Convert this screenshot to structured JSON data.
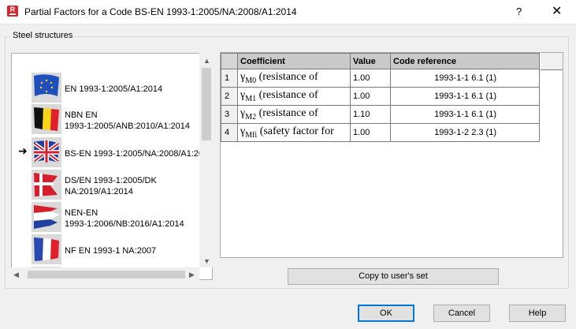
{
  "window": {
    "title": "Partial Factors for a Code BS-EN 1993-1:2005/NA:2008/A1:2014",
    "app_icon_letter": "R",
    "help": "?",
    "close": "✕"
  },
  "group": {
    "label": "Steel structures"
  },
  "codes": [
    {
      "line1": "EN 1993-1:2005/A1:2014",
      "line2": "",
      "flag": "eu-flag-icon",
      "selected": false
    },
    {
      "line1": "NBN EN",
      "line2": "1993-1:2005/ANB:2010/A1:2014",
      "flag": "belgium-flag-icon",
      "selected": false
    },
    {
      "line1": "BS-EN 1993-1:2005/NA:2008/A1:20",
      "line2": "",
      "flag": "uk-flag-icon",
      "selected": true
    },
    {
      "line1": "DS/EN 1993-1:2005/DK",
      "line2": "NA:2019/A1:2014",
      "flag": "denmark-flag-icon",
      "selected": false
    },
    {
      "line1": "NEN-EN",
      "line2": "1993-1:2006/NB:2016/A1:2014",
      "flag": "netherlands-flag-icon",
      "selected": false
    },
    {
      "line1": "NF EN 1993-1 NA:2007",
      "line2": "",
      "flag": "france-flag-icon",
      "selected": false
    }
  ],
  "pointer": "➜",
  "table": {
    "headers": {
      "coefficient": "Coefficient",
      "value": "Value",
      "reference": "Code reference"
    },
    "rows": [
      {
        "num": "1",
        "symbol": "γ",
        "sub": "M0",
        "desc": " (resistance of",
        "value": "1.00",
        "ref": "1993-1-1  6.1 (1)"
      },
      {
        "num": "2",
        "symbol": "γ",
        "sub": "M1",
        "desc": " (resistance of",
        "value": "1.00",
        "ref": "1993-1-1  6.1 (1)"
      },
      {
        "num": "3",
        "symbol": "γ",
        "sub": "M2",
        "desc": " (resistance of",
        "value": "1.10",
        "ref": "1993-1-1  6.1 (1)"
      },
      {
        "num": "4",
        "symbol": "γ",
        "sub": "Mfi",
        "desc": " (safety factor for",
        "value": "1.00",
        "ref": "1993-1-2  2.3 (1)"
      }
    ]
  },
  "buttons": {
    "copy": "Copy to user's set",
    "ok": "OK",
    "cancel": "Cancel",
    "help": "Help"
  },
  "scroll_arrows": {
    "up": "▲",
    "down": "▼",
    "left": "◀",
    "right": "▶"
  }
}
